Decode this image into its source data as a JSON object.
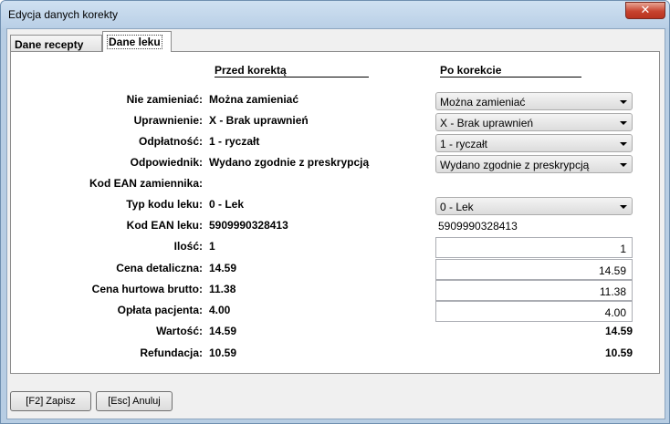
{
  "window": {
    "title": "Edycja danych korekty",
    "close_glyph": "✕"
  },
  "tabs": [
    {
      "label": "Dane recepty"
    },
    {
      "label": "Dane leku"
    }
  ],
  "headers": {
    "before": "Przed korektą",
    "after": "Po korekcie"
  },
  "rows": {
    "nie_zamieniac": {
      "label": "Nie zamieniać:",
      "before": "Można zamieniać",
      "after": "Można zamieniać"
    },
    "uprawnienie": {
      "label": "Uprawnienie:",
      "before": "X - Brak uprawnień",
      "after": "X - Brak uprawnień"
    },
    "odplatnosc": {
      "label": "Odpłatność:",
      "before": "1 - ryczałt",
      "after": "1 - ryczałt"
    },
    "odpowiednik": {
      "label": "Odpowiednik:",
      "before": "Wydano zgodnie z preskrypcją",
      "after": "Wydano zgodnie z preskrypcją"
    },
    "kod_ean_zamiennika": {
      "label": "Kod EAN zamiennika:",
      "before": "",
      "after": ""
    },
    "typ_kodu_leku": {
      "label": "Typ kodu leku:",
      "before": "0 - Lek",
      "after": "0 - Lek"
    },
    "kod_ean_leku": {
      "label": "Kod EAN leku:",
      "before": "5909990328413",
      "after": "5909990328413"
    },
    "ilosc": {
      "label": "Ilość:",
      "before": "1",
      "after": "1"
    },
    "cena_detaliczna": {
      "label": "Cena detaliczna:",
      "before": "14.59",
      "after": "14.59"
    },
    "cena_hurtowa": {
      "label": "Cena hurtowa brutto:",
      "before": "11.38",
      "after": "11.38"
    },
    "oplata_pacjenta": {
      "label": "Opłata pacjenta:",
      "before": "4.00",
      "after": "4.00"
    },
    "wartosc": {
      "label": "Wartość:",
      "before": "14.59",
      "after": "14.59"
    },
    "refundacja": {
      "label": "Refundacja:",
      "before": "10.59",
      "after": "10.59"
    }
  },
  "buttons": {
    "save": "[F2] Zapisz",
    "cancel": "[Esc] Anuluj"
  }
}
